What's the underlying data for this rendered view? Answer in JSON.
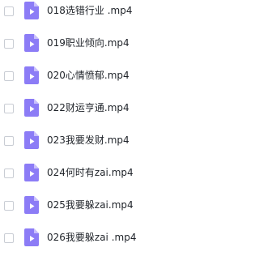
{
  "files": [
    {
      "name": "018选错行业 .mp4",
      "icon": "video-file-icon"
    },
    {
      "name": "019职业倾向.mp4",
      "icon": "video-file-icon"
    },
    {
      "name": "020心情愤郁.mp4",
      "icon": "video-file-icon"
    },
    {
      "name": "022财运亨通.mp4",
      "icon": "video-file-icon"
    },
    {
      "name": "023我要发财.mp4",
      "icon": "video-file-icon"
    },
    {
      "name": "024何时有zai.mp4",
      "icon": "video-file-icon"
    },
    {
      "name": "025我要躲zai.mp4",
      "icon": "video-file-icon"
    },
    {
      "name": "026我要躲zai .mp4",
      "icon": "video-file-icon"
    }
  ],
  "colors": {
    "icon_body": "#8c7cf6",
    "icon_fold": "#c9c0fb",
    "icon_play": "#ffffff",
    "checkbox_border": "#c9cdd4",
    "text": "#1f2329"
  }
}
